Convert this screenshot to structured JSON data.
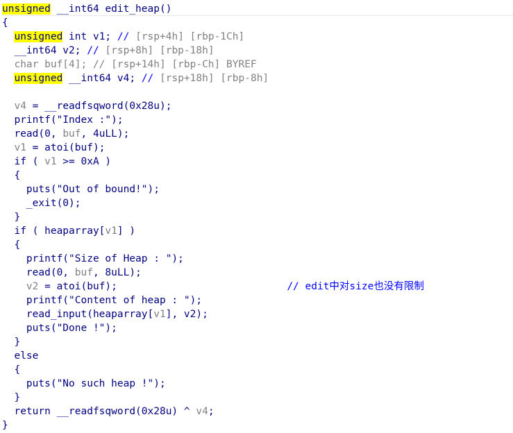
{
  "decompiler": {
    "function_name": "edit_heap",
    "colors": {
      "background": "#ffffff",
      "code_text": "#000080",
      "keyword_highlight": "#ffff00",
      "comment": "#0000ff",
      "variable_gray": "#808080"
    },
    "lines": [
      [
        {
          "t": "unsigned",
          "c": "hl"
        },
        {
          "t": " __int64 edit_heap()"
        }
      ],
      [
        {
          "t": "{"
        }
      ],
      [
        {
          "t": "  "
        },
        {
          "t": "unsigned",
          "c": "hl"
        },
        {
          "t": " int v1; "
        },
        {
          "t": "// ",
          "c": "cm"
        },
        {
          "t": "[rsp+4h] [rbp-1Ch]",
          "c": "gr"
        }
      ],
      [
        {
          "t": "  __int64 v2; "
        },
        {
          "t": "// ",
          "c": "cm"
        },
        {
          "t": "[rsp+8h] [rbp-18h]",
          "c": "gr"
        }
      ],
      [
        {
          "t": "  char buf[4]; // [rsp+14h] [rbp-Ch] BYREF",
          "c": "gr"
        }
      ],
      [
        {
          "t": "  "
        },
        {
          "t": "unsigned",
          "c": "hl"
        },
        {
          "t": " __int64 v4; "
        },
        {
          "t": "// ",
          "c": "cm"
        },
        {
          "t": "[rsp+18h] [rbp-8h]",
          "c": "gr"
        }
      ],
      [
        {
          "t": ""
        }
      ],
      [
        {
          "t": "  "
        },
        {
          "t": "v4",
          "c": "gr"
        },
        {
          "t": " = __readfsqword(0x28u);"
        }
      ],
      [
        {
          "t": "  printf(\"Index :\");"
        }
      ],
      [
        {
          "t": "  read(0, "
        },
        {
          "t": "buf",
          "c": "gr"
        },
        {
          "t": ", 4uLL);"
        }
      ],
      [
        {
          "t": "  "
        },
        {
          "t": "v1",
          "c": "gr"
        },
        {
          "t": " = atoi(buf);"
        }
      ],
      [
        {
          "t": "  if ( "
        },
        {
          "t": "v1",
          "c": "gr"
        },
        {
          "t": " >= 0xA )"
        }
      ],
      [
        {
          "t": "  {"
        }
      ],
      [
        {
          "t": "    puts(\"Out of bound!\");"
        }
      ],
      [
        {
          "t": "    _exit(0);"
        }
      ],
      [
        {
          "t": "  }"
        }
      ],
      [
        {
          "t": "  if ( heaparray["
        },
        {
          "t": "v1",
          "c": "gr"
        },
        {
          "t": "] )"
        }
      ],
      [
        {
          "t": "  {"
        }
      ],
      [
        {
          "t": "    printf(\"Size of Heap : \");"
        }
      ],
      [
        {
          "t": "    read(0, "
        },
        {
          "t": "buf",
          "c": "gr"
        },
        {
          "t": ", 8uLL);"
        }
      ],
      [
        {
          "t": "    "
        },
        {
          "t": "v2",
          "c": "gr"
        },
        {
          "t": " = atoi(buf);                            "
        },
        {
          "t": "// edit中对size也没有限制",
          "c": "cm"
        }
      ],
      [
        {
          "t": "    printf(\"Content of heap : \");"
        }
      ],
      [
        {
          "t": "    read_input(heaparray["
        },
        {
          "t": "v1",
          "c": "gr"
        },
        {
          "t": "], v2);"
        }
      ],
      [
        {
          "t": "    puts(\"Done !\");"
        }
      ],
      [
        {
          "t": "  }"
        }
      ],
      [
        {
          "t": "  else"
        }
      ],
      [
        {
          "t": "  {"
        }
      ],
      [
        {
          "t": "    puts(\"No such heap !\");"
        }
      ],
      [
        {
          "t": "  }"
        }
      ],
      [
        {
          "t": "  return __readfsqword(0x28u) ^ "
        },
        {
          "t": "v4",
          "c": "gr"
        },
        {
          "t": ";"
        }
      ],
      [
        {
          "t": "}"
        }
      ]
    ]
  }
}
